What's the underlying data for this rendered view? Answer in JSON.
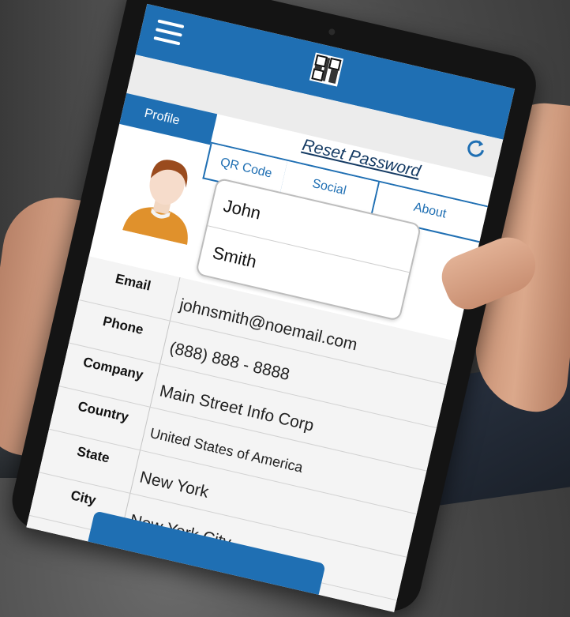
{
  "header": {
    "menu_icon": "hamburger-menu-icon",
    "qr_icon": "qr-code-icon",
    "refresh_icon": "refresh-icon",
    "brand_color": "#1f6fb3"
  },
  "tabs": {
    "profile": "Profile",
    "qr_code": "QR Code",
    "social": "Social",
    "about": "About",
    "reset_password": "Reset Password"
  },
  "profile": {
    "avatar_icon": "person-avatar-icon",
    "first_name": "John",
    "last_name": "Smith"
  },
  "details": [
    {
      "label": "Email",
      "value": "johnsmith@noemail.com"
    },
    {
      "label": "Phone",
      "value": "(888) 888 - 8888"
    },
    {
      "label": "Company",
      "value": "Main Street Info Corp"
    },
    {
      "label": "Country",
      "value": "United States of America"
    },
    {
      "label": "State",
      "value": "New York"
    },
    {
      "label": "City",
      "value": "New York City"
    }
  ]
}
